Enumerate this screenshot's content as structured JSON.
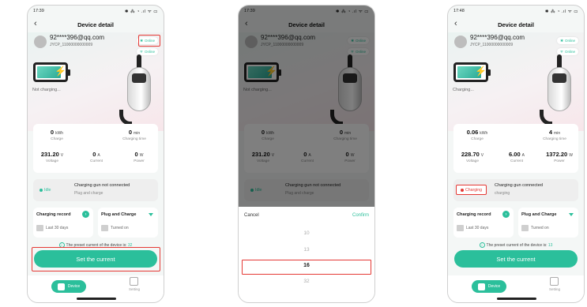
{
  "phones": [
    {
      "status_time": "17:39",
      "status_icons": "✱ ⁂ ◔ .ıl ᯤ ▭",
      "title": "Device detail",
      "email": "92****396@qq.com",
      "device_id": "JYCP_11000000000009",
      "bt_label": "Online",
      "wifi_label": "Online",
      "battery_status": "Not charging...",
      "charge_value": "0",
      "charge_unit": "kWh",
      "charge_label": "Charge",
      "time_value": "0",
      "time_unit": "min",
      "time_label": "Charging time",
      "voltage_value": "231.20",
      "voltage_unit": "V",
      "voltage_label": "Voltage",
      "current_value": "0",
      "current_unit": "A",
      "current_label": "Current",
      "power_value": "0",
      "power_unit": "W",
      "power_label": "Power",
      "state_badge": "Idle",
      "state_title": "Charging gun not connected",
      "state_sub": "Plug and charge",
      "record_title": "Charging record",
      "record_sub": "Last 30 days",
      "mode_title": "Plug and Charge",
      "mode_sub": "Turned on",
      "preset_text": "The preset current of the device is:",
      "preset_value": "32",
      "set_button": "Set the current",
      "tab_device": "Device",
      "tab_setting": "Setting"
    },
    {
      "status_time": "17:39",
      "status_icons": "✱ ⁂ ◔ .ıl ᯤ ▭",
      "title": "Device detail",
      "email": "92****396@qq.com",
      "device_id": "JYCP_11000000000009",
      "bt_label": "Online",
      "wifi_label": "Online",
      "battery_status": "Not charging...",
      "charge_value": "0",
      "charge_unit": "kWh",
      "charge_label": "Charge",
      "time_value": "0",
      "time_unit": "min",
      "time_label": "Charging time",
      "voltage_value": "231.20",
      "voltage_unit": "V",
      "voltage_label": "Voltage",
      "current_value": "0",
      "current_unit": "A",
      "current_label": "Current",
      "power_value": "0",
      "power_unit": "W",
      "power_label": "Power",
      "state_badge": "Idle",
      "state_title": "Charging gun not connected",
      "state_sub": "Plug and charge",
      "picker_cancel": "Cancel",
      "picker_confirm": "Confirm",
      "picker_options": [
        "10",
        "13",
        "16",
        "32"
      ],
      "picker_selected": "16"
    },
    {
      "status_time": "17:48",
      "status_icons": "✱ ⁂ ◔ .ıl ᯤ ▭",
      "title": "Device detail",
      "email": "92****396@qq.com",
      "device_id": "JYCP_11000000000009",
      "bt_label": "Online",
      "wifi_label": "Online",
      "battery_status": "Charging...",
      "charge_value": "0.06",
      "charge_unit": "kWh",
      "charge_label": "Charge",
      "time_value": "4",
      "time_unit": "min",
      "time_label": "Charging time",
      "voltage_value": "228.70",
      "voltage_unit": "V",
      "voltage_label": "Voltage",
      "current_value": "6.00",
      "current_unit": "A",
      "current_label": "Current",
      "power_value": "1372.20",
      "power_unit": "W",
      "power_label": "Power",
      "state_badge": "Charging",
      "state_title": "Charging gun connected",
      "state_sub": "charging",
      "record_title": "Charging record",
      "record_sub": "Last 30 days",
      "mode_title": "Plug and Charge",
      "mode_sub": "Turned on",
      "preset_text": "The preset current of the device is:",
      "preset_value": "13",
      "set_button": "Set the current",
      "tab_device": "Device",
      "tab_setting": "Setting"
    }
  ],
  "colors": {
    "accent": "#2bbf9b",
    "highlight": "#e53935",
    "idle": "#2bbf9b",
    "charging": "#e53935"
  }
}
